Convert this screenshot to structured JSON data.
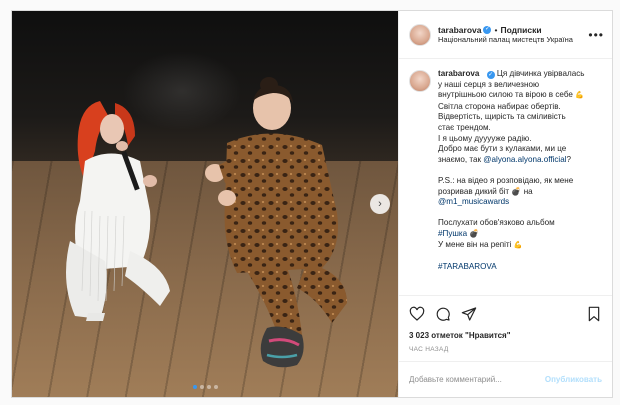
{
  "post": {
    "header": {
      "username": "tarabarova",
      "separator": "•",
      "follow_label": "Подписки",
      "location": "Національний палац мистецтв Україна",
      "more_icon": "more-horizontal-icon"
    },
    "caption": {
      "username": "tarabarova",
      "lines": [
        "Ця дівчинка увірвалась",
        "у наші серця з величезною",
        "внутрішньою силою та вірою в себе",
        "Світла сторона набирає обертів.",
        "Відвертість, щирість та сміливість",
        "стає трендом.",
        "І я цьому дууууже радію.",
        "Добро має бути з кулаками, ми це",
        "знаємо, так ",
        "",
        "P.S.: на відео я розповідаю, як мене",
        "розривав дикий біт",
        " на",
        "",
        "Послухати обов'язково альбом",
        "",
        "У мене він на репіті",
        "",
        "#TARABAROVA"
      ],
      "mention_alyona": "@alyona.alyona.official",
      "question_mark": "?",
      "mention_m1": "@m1_musicawards",
      "hashtag_pushka": "#Пушка"
    },
    "media": {
      "carousel_total": 4,
      "carousel_active": 0,
      "next_icon": "chevron-right-icon"
    },
    "actions": {
      "like_icon": "heart-icon",
      "comment_icon": "comment-icon",
      "share_icon": "share-icon",
      "save_icon": "bookmark-icon"
    },
    "likes_text": "3 023 отметок \"Нравится\"",
    "time_text": "ЧАС НАЗАД",
    "comment": {
      "placeholder": "Добавьте комментарий...",
      "publish_label": "Опубликовать"
    },
    "colors": {
      "verified": "#3897f0",
      "link": "#00376b",
      "publish_disabled": "#b2dffc",
      "muted": "#8e8e8e"
    }
  }
}
